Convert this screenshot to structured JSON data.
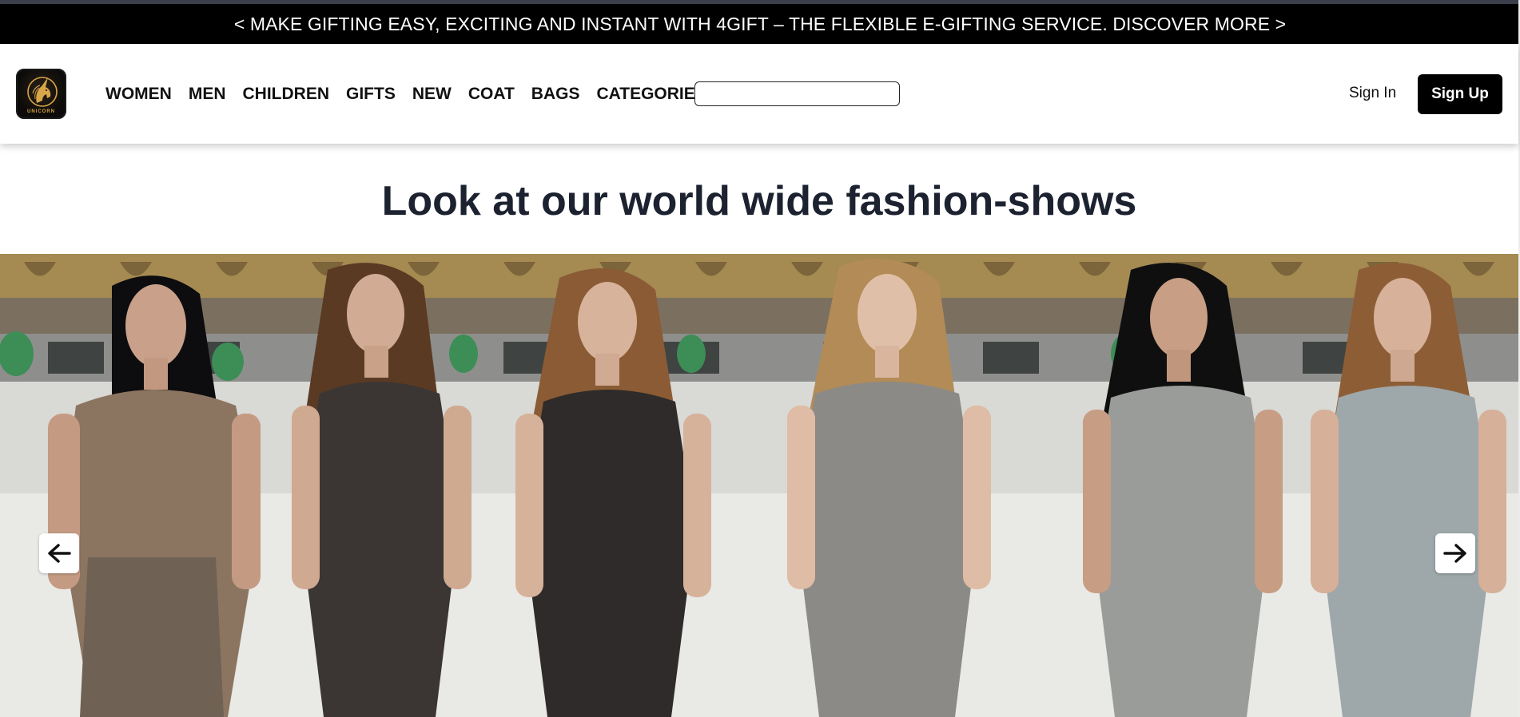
{
  "announcement": {
    "text": "< MAKE GIFTING EASY, EXCITING AND INSTANT WITH 4GIFT – THE FLEXIBLE E-GIFTING SERVICE. DISCOVER MORE >"
  },
  "brand": {
    "logo_text": "UNICORN",
    "icon": "unicorn-logo-icon",
    "gold": "#d8a548"
  },
  "nav": {
    "links": [
      "WOMEN",
      "MEN",
      "CHILDREN",
      "GIFTS",
      "NEW",
      "COAT",
      "BAGS",
      "CATEGORIES"
    ]
  },
  "search": {
    "value": "",
    "placeholder": ""
  },
  "auth": {
    "sign_in": "Sign In",
    "sign_up": "Sign Up"
  },
  "hero": {
    "heading": "Look at our world wide fashion-shows"
  },
  "carousel": {
    "prev_icon": "arrow-left-icon",
    "next_icon": "arrow-right-icon"
  },
  "colors": {
    "announcement_bg": "#000000",
    "heading": "#1c2230",
    "signup_bg": "#000000"
  }
}
